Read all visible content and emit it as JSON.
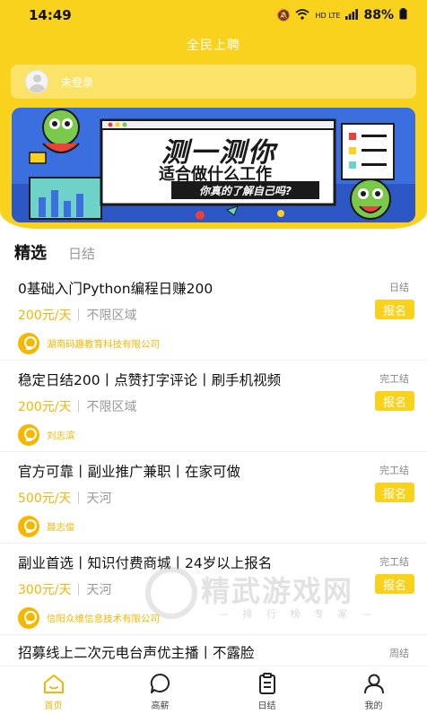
{
  "status_bar": {
    "time": "14:49",
    "network": "HD LTE",
    "battery": "88%"
  },
  "header": {
    "title": "全民上聘",
    "login_text": "未登录"
  },
  "banner": {
    "headline": "测一测你",
    "subline": "适合做什么工作",
    "tagline": "你真的了解自己吗?"
  },
  "tabs": [
    {
      "label": "精选",
      "active": true
    },
    {
      "label": "日结",
      "active": false
    }
  ],
  "jobs": [
    {
      "title": "0基础入门Python编程日赚200",
      "type": "日结",
      "salary": "200元/天",
      "area": "不限区域",
      "apply": "报名",
      "company": "湖南码趣教育科技有限公司"
    },
    {
      "title": "稳定日结200丨点赞打字评论丨刷手机视频",
      "type": "完工结",
      "salary": "200元/天",
      "area": "不限区域",
      "apply": "报名",
      "company": "刘志滨"
    },
    {
      "title": "官方可靠丨副业推广兼职丨在家可做",
      "type": "完工结",
      "salary": "500元/天",
      "area": "天河",
      "apply": "报名",
      "company": "聂志俊"
    },
    {
      "title": "副业首选丨知识付费商城丨24岁以上报名",
      "type": "完工结",
      "salary": "300元/天",
      "area": "天河",
      "apply": "报名",
      "company": "信阳众维信息技术有限公司"
    },
    {
      "title": "招募线上二次元电台声优主播丨不露脸",
      "type": "周结"
    }
  ],
  "watermark": {
    "title": "精武游戏网",
    "subtitle": "— 排 行 榜 专 家 —"
  },
  "nav": [
    {
      "label": "首页",
      "icon": "home-icon",
      "active": true
    },
    {
      "label": "高薪",
      "icon": "chat-bubble-icon",
      "active": false
    },
    {
      "label": "日结",
      "icon": "clipboard-icon",
      "active": false
    },
    {
      "label": "我的",
      "icon": "person-icon",
      "active": false
    }
  ],
  "colors": {
    "brand_yellow": "#f9d21e",
    "salary_yellow": "#f2b705",
    "banner_blue": "#3b6fe0"
  }
}
